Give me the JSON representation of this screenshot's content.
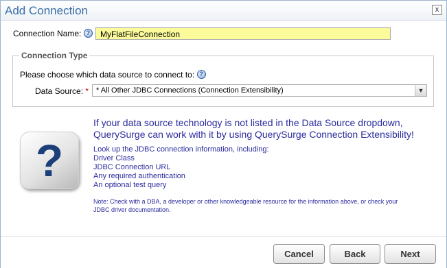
{
  "dialog": {
    "title": "Add Connection",
    "close_label": "x"
  },
  "connection": {
    "name_label": "Connection Name:",
    "name_value": "MyFlatFileConnection"
  },
  "connection_type": {
    "legend": "Connection Type",
    "prompt": "Please choose which data source to connect to:",
    "data_source_label": "Data Source:",
    "required_mark": "*",
    "data_source_value": "* All Other JDBC Connections (Connection Extensibility)"
  },
  "info": {
    "heading_line1": "If your data source technology is not listed in the Data Source dropdown,",
    "heading_line2": "QuerySurge can work with it by using QuerySurge Connection Extensibility!",
    "lookup_intro": "Look up the JDBC connection information, including:",
    "items": [
      "Driver Class",
      "JDBC Connection URL",
      "Any required authentication",
      "An optional test query"
    ],
    "note_line1": "Note: Check with a DBA, a developer or other knowledgeable resource for the information above, or check your",
    "note_line2": "JDBC driver documentation."
  },
  "buttons": {
    "cancel": "Cancel",
    "back": "Back",
    "next": "Next"
  },
  "icons": {
    "help": "help-icon",
    "question": "question-mark-icon",
    "dropdown": "chevron-down-icon",
    "close": "close-icon"
  }
}
